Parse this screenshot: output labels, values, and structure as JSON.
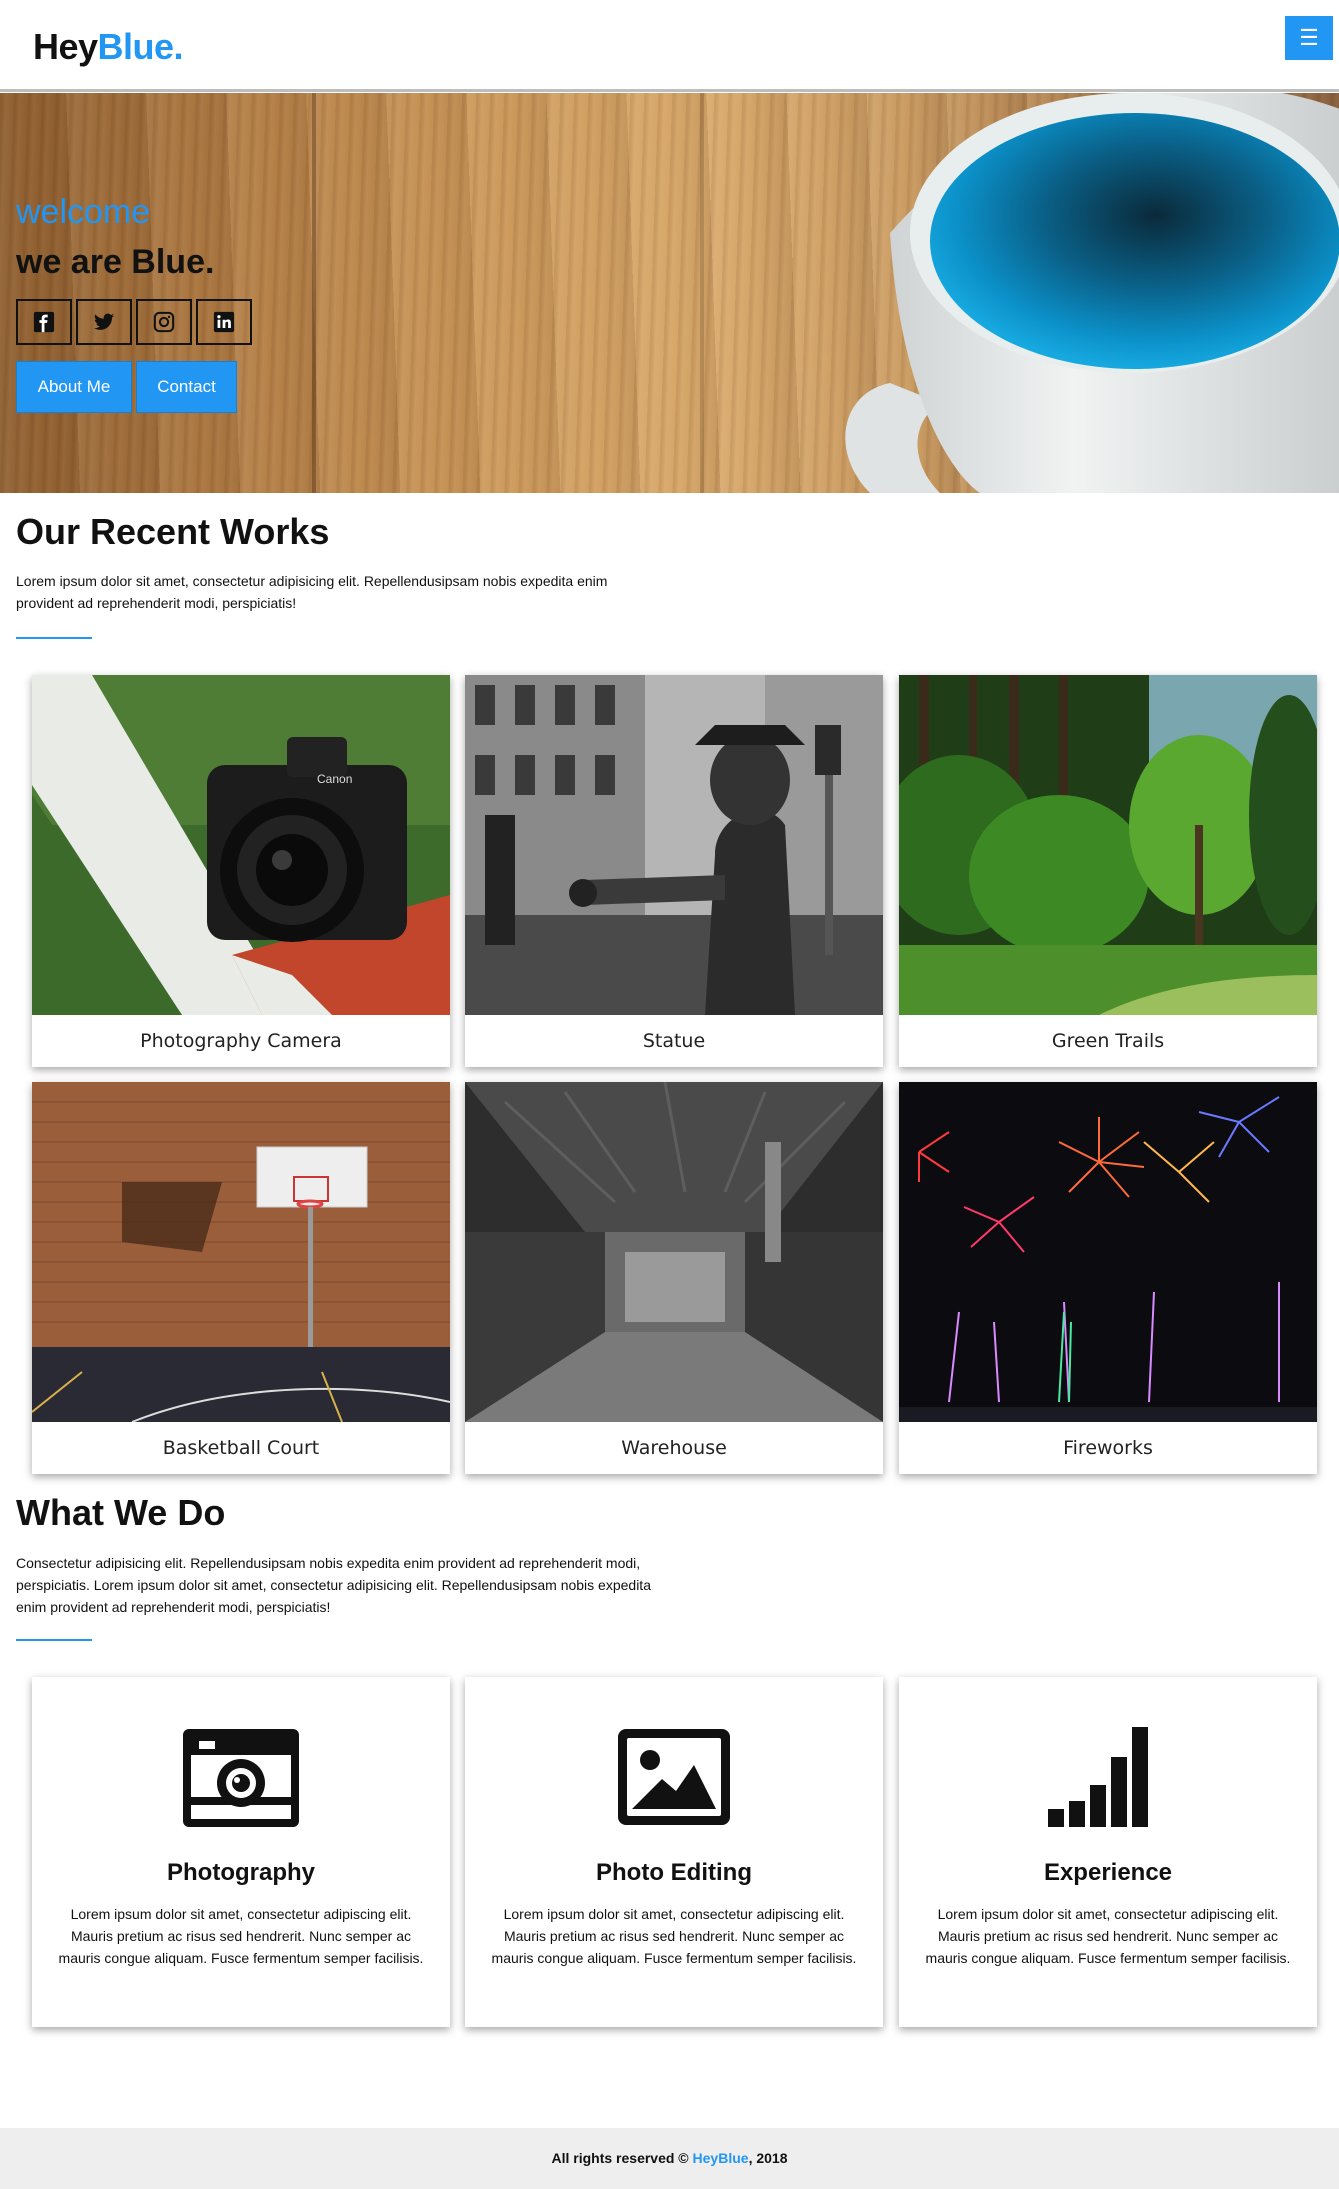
{
  "header": {
    "logo_prefix": "Hey",
    "logo_suffix": "Blue.",
    "menu_icon": "hamburger-icon",
    "menu_glyph": "☰",
    "accent_color": "#2196f3"
  },
  "hero": {
    "welcome": "welcome",
    "tagline": "we are Blue.",
    "social_icons": [
      "facebook-icon",
      "twitter-icon",
      "instagram-icon",
      "linkedin-icon"
    ],
    "about_label": "About Me",
    "contact_label": "Contact"
  },
  "works": {
    "title": "Our Recent Works",
    "text": "Lorem ipsum dolor sit amet, consectetur adipisicing elit. Repellendusipsam nobis expedita enim provident ad reprehenderit modi, perspiciatis!",
    "items": [
      {
        "caption": "Photography Camera"
      },
      {
        "caption": "Statue"
      },
      {
        "caption": "Green Trails"
      },
      {
        "caption": "Basketball Court"
      },
      {
        "caption": "Warehouse"
      },
      {
        "caption": "Fireworks"
      }
    ]
  },
  "services": {
    "title": "What We Do",
    "text": "Consectetur adipisicing elit. Repellendusipsam nobis expedita enim provident ad reprehenderit modi, perspiciatis. Lorem ipsum dolor sit amet, consectetur adipisicing elit. Repellendusipsam nobis expedita enim provident ad reprehenderit modi, perspiciatis!",
    "items": [
      {
        "title": "Photography",
        "icon": "camera-icon",
        "text": "Lorem ipsum dolor sit amet, consectetur adipiscing elit. Mauris pretium ac risus sed hendrerit. Nunc semper ac mauris congue aliquam. Fusce fermentum semper facilisis."
      },
      {
        "title": "Photo Editing",
        "icon": "image-icon",
        "text": "Lorem ipsum dolor sit amet, consectetur adipiscing elit. Mauris pretium ac risus sed hendrerit. Nunc semper ac mauris congue aliquam. Fusce fermentum semper facilisis."
      },
      {
        "title": "Experience",
        "icon": "signal-bars-icon",
        "text": "Lorem ipsum dolor sit amet, consectetur adipiscing elit. Mauris pretium ac risus sed hendrerit. Nunc semper ac mauris congue aliquam. Fusce fermentum semper facilisis."
      }
    ]
  },
  "footer": {
    "prefix": "All rights reserved © ",
    "brand": "HeyBlue",
    "suffix": ", 2018"
  }
}
